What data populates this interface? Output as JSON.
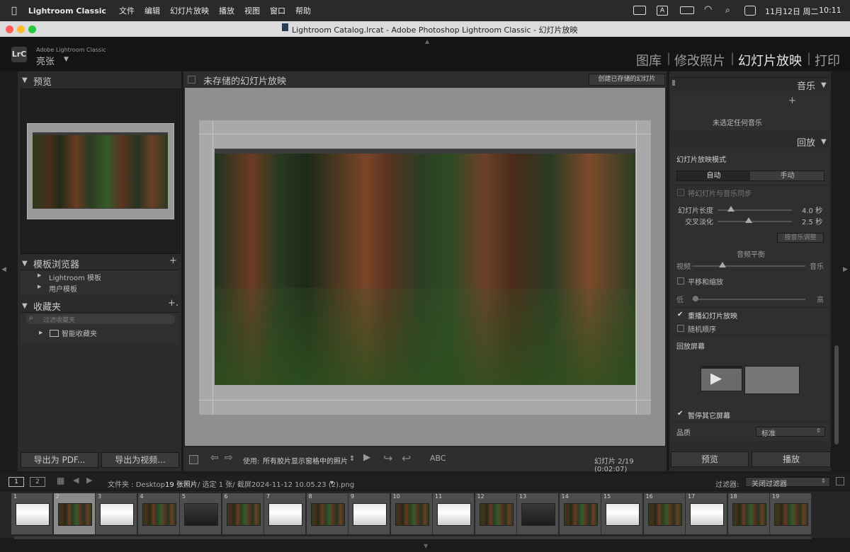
{
  "menubar": {
    "app": "Lightroom Classic",
    "items": [
      "文件",
      "编辑",
      "幻灯片放映",
      "播放",
      "视图",
      "窗口",
      "帮助"
    ],
    "date": "11月12日 周二",
    "time": "10:11"
  },
  "window_title": "Lightroom Catalog.lrcat - Adobe Photoshop Lightroom Classic - 幻灯片放映",
  "identity": {
    "logo": "LrC",
    "product": "Adobe Lightroom Classic",
    "user": "亮张",
    "modules": [
      "图库",
      "修改照片",
      "幻灯片放映",
      "打印"
    ],
    "active_module": "幻灯片放映"
  },
  "left": {
    "preview_header": "预览",
    "template_header": "模板浏览器",
    "templates": [
      "Lightroom 模板",
      "用户模板"
    ],
    "collections_header": "收藏夹",
    "filter_placeholder": "过滤收藏夹",
    "smart_collections": "智能收藏夹",
    "export_pdf": "导出为 PDF...",
    "export_video": "导出为视频..."
  },
  "center": {
    "title": "未存储的幻灯片放映",
    "create_button": "创建已存储的幻灯片",
    "use_label": "使用:",
    "use_value": "所有胶片显示窗格中的照片",
    "abc": "ABC",
    "slide_counter": "幻灯片 2/19 (0:02:07)"
  },
  "right": {
    "music_header": "音乐",
    "music_empty": "未选定任何音乐",
    "playback_header": "回放",
    "slideshow_mode": "幻灯片放映模式",
    "mode_auto": "自动",
    "mode_manual": "手动",
    "sync_music": "将幻灯片与音乐同步",
    "slide_length_label": "幻灯片长度",
    "slide_length_value": "4.0 秒",
    "crossfade_label": "交叉淡化",
    "crossfade_value": "2.5 秒",
    "fit_music": "按音乐调整",
    "audio_balance": "音频平衡",
    "video_label": "视频",
    "music_label": "音乐",
    "pan_zoom": "平移和缩放",
    "low": "低",
    "high": "高",
    "repeat": "重播幻灯片放映",
    "random": "随机顺序",
    "playback_screen": "回放屏幕",
    "pause_other": "暂停其它屏幕",
    "quality_label": "品质",
    "quality_value": "标准",
    "preview_button": "预览",
    "play_button": "播放"
  },
  "filmstrip": {
    "page1": "1",
    "page2": "2",
    "folder_label": "文件夹 : Desktop",
    "count": "19 张照片",
    "selected": "/ 选定 1 张/ 截屏2024-11-12 10.05.23 (2).png",
    "filter_label": "过滤器:",
    "filter_value": "关闭过滤器",
    "thumbs": [
      "1",
      "2",
      "3",
      "4",
      "5",
      "6",
      "7",
      "8",
      "9",
      "10",
      "11",
      "12",
      "13",
      "14",
      "15",
      "16",
      "17",
      "18",
      "19"
    ]
  }
}
